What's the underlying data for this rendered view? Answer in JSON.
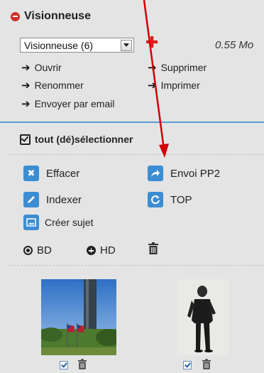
{
  "header": {
    "title": "Visionneuse",
    "collapse_icon": "minus-circle-icon"
  },
  "viewer_select": {
    "value": "Visionneuse (6)",
    "add_icon": "plus-icon",
    "size": "0.55 Mo"
  },
  "actions": {
    "open": "Ouvrir",
    "delete": "Supprimer",
    "rename": "Renommer",
    "print": "Imprimer",
    "email": "Envoyer par email"
  },
  "select_all": "tout (dé)sélectionner",
  "buttons": {
    "erase": "Effacer",
    "send_pp2": "Envoi PP2",
    "index": "Indexer",
    "top": "TOP",
    "create_subject": "Créer sujet"
  },
  "downloads": {
    "bd": "BD",
    "hd": "HD"
  },
  "colors": {
    "accent_blue": "#3c8dd2",
    "separator_blue": "#5b9bd5",
    "annotation_red": "#d00000",
    "panel_bg": "#e4e4e4"
  },
  "thumbnails": [
    {
      "icon": "photo-memorial-flags",
      "checked": true
    },
    {
      "icon": "photo-soldier-portrait",
      "checked": true
    }
  ]
}
